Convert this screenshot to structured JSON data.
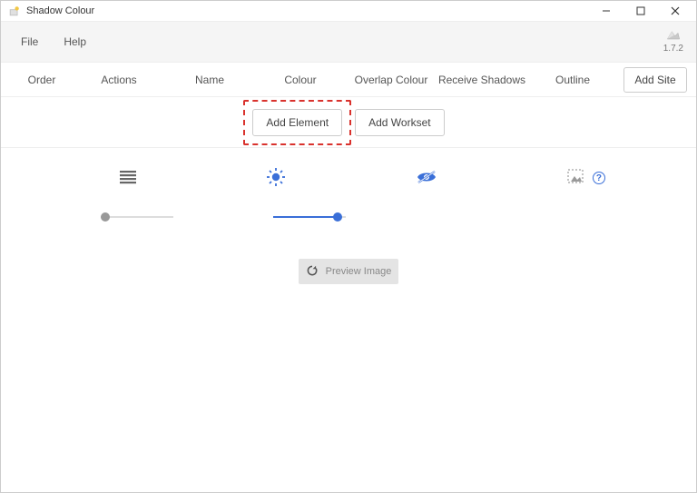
{
  "window": {
    "title": "Shadow Colour"
  },
  "version": "1.7.2",
  "menu": {
    "file": "File",
    "help": "Help"
  },
  "headers": {
    "order": "Order",
    "actions": "Actions",
    "name": "Name",
    "colour": "Colour",
    "overlap": "Overlap Colour",
    "receive": "Receive Shadows",
    "outline": "Outline"
  },
  "buttons": {
    "add_site": "Add Site",
    "add_element": "Add Element",
    "add_workset": "Add Workset",
    "preview": "Preview Image"
  },
  "help_glyph": "?"
}
